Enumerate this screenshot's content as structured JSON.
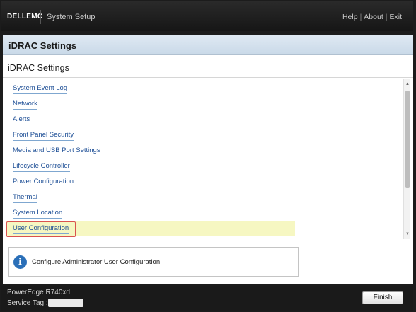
{
  "topbar": {
    "logo": "DELLEMC",
    "app_title": "System Setup",
    "nav": [
      "Help",
      "About",
      "Exit"
    ]
  },
  "panel": {
    "page_header": "iDRAC Settings",
    "section_title": "iDRAC Settings",
    "items": [
      {
        "label": "System Event Log"
      },
      {
        "label": "Network"
      },
      {
        "label": "Alerts"
      },
      {
        "label": "Front Panel Security"
      },
      {
        "label": "Media and USB Port Settings"
      },
      {
        "label": "Lifecycle Controller"
      },
      {
        "label": "Power Configuration"
      },
      {
        "label": "Thermal"
      },
      {
        "label": "System Location"
      },
      {
        "label": "User Configuration"
      }
    ],
    "selected_index": 9,
    "help_text": "Configure Administrator User Configuration."
  },
  "footer": {
    "model": "PowerEdge R740xd",
    "service_tag_label": "Service Tag :",
    "service_tag_value": "",
    "finish_label": "Finish"
  },
  "icons": {
    "info": "info-icon",
    "scroll_up": "scroll-up-arrow-icon",
    "scroll_down": "scroll-down-arrow-icon"
  },
  "colors": {
    "link": "#1e4f96",
    "selected_row": "#f6f7c2",
    "focus_border": "#d9534f",
    "info_icon": "#2a6fb8"
  }
}
